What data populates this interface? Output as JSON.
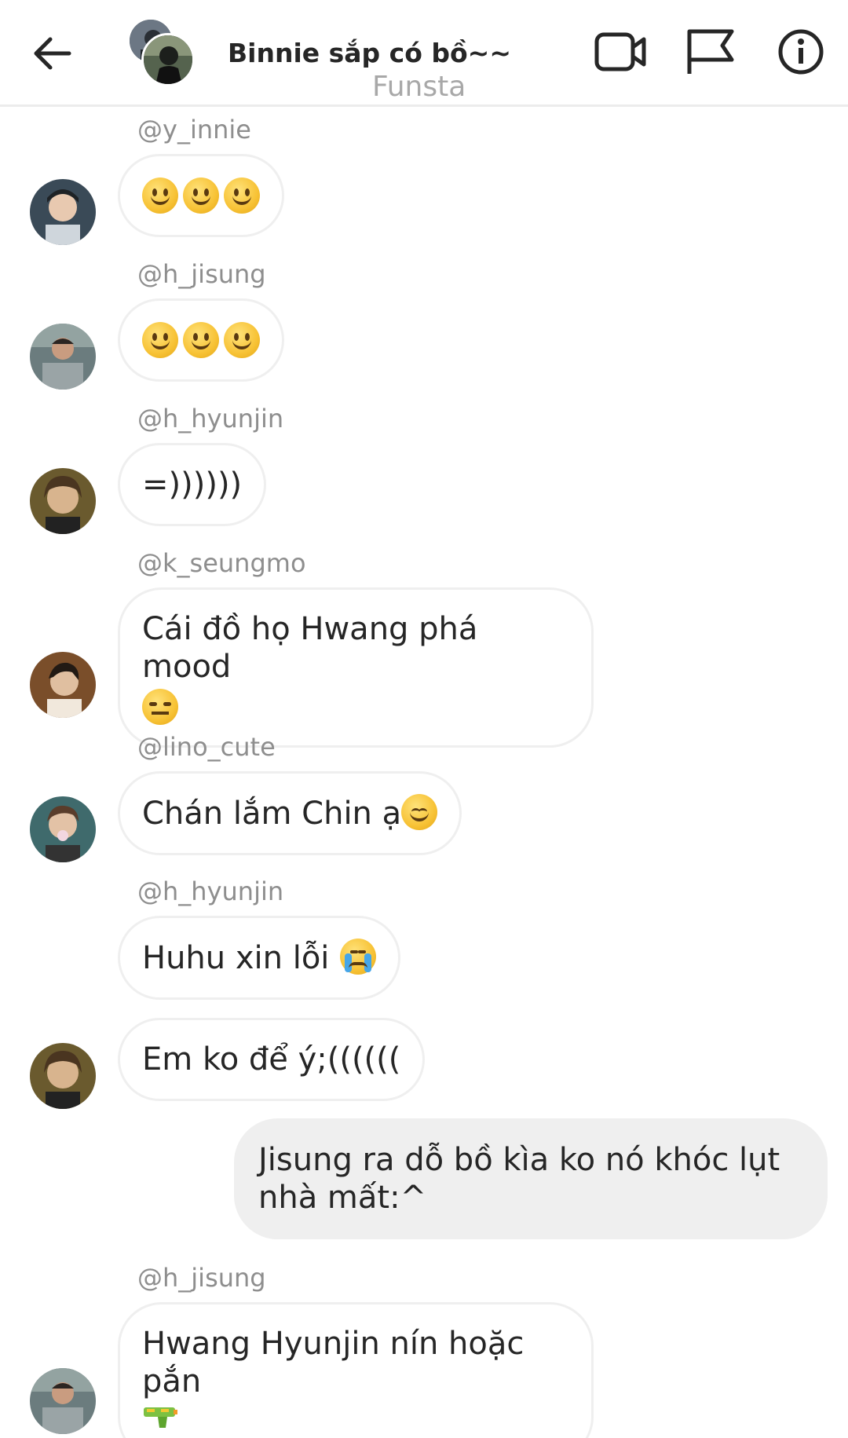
{
  "header": {
    "title": "Binnie sắp có bồ~~",
    "subtitle": "Funsta",
    "icons": [
      "back-arrow-icon",
      "video-call-icon",
      "flag-icon",
      "info-icon"
    ]
  },
  "messages": [
    {
      "username": "@y_innie",
      "text": "",
      "emoji": "slightly-smiling-face x3"
    },
    {
      "username": "@h_jisung",
      "text": "",
      "emoji": "slightly-smiling-face x3"
    },
    {
      "username": "@h_hyunjin",
      "text": "=))))))"
    },
    {
      "username": "@k_seungmo",
      "text": "Cái đồ họ Hwang phá mood",
      "emoji": "unamused-face"
    },
    {
      "username": "@lino_cute",
      "text": "Chán lắm Chin ạ",
      "emoji": "relieved-face"
    },
    {
      "username": "@h_hyunjin",
      "text": "Huhu xin lỗi",
      "emoji": "loudly-crying-face"
    },
    {
      "username": "",
      "text": "Em ko để ý;(((((("
    },
    {
      "username": "",
      "text": "Jisung ra dỗ bồ kìa ko nó khóc lụt nhà mất:^",
      "sender": "me"
    },
    {
      "username": "@h_jisung",
      "text": "Hwang Hyunjin nín hoặc pắn",
      "emoji": "water-pistol"
    }
  ],
  "colors": {
    "bubble_border": "#efefef",
    "my_bubble": "#efefef",
    "username_text": "#8e8e8e",
    "subtitle_text": "#a8a8a8",
    "text": "#262626"
  }
}
